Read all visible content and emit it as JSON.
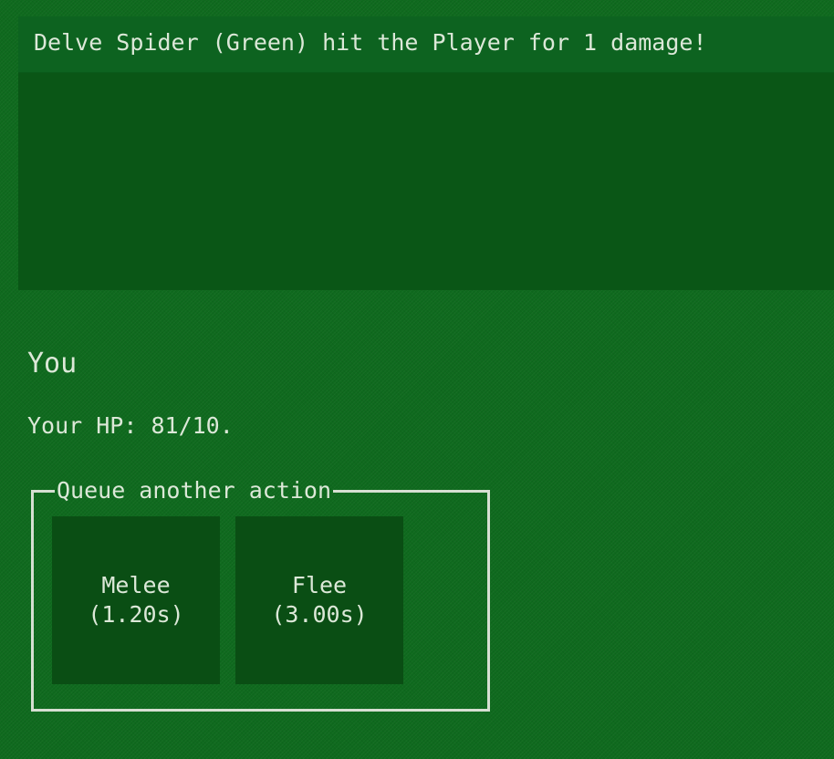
{
  "log": {
    "entries": [
      "Delve Spider (Green) hit the Player for 1 damage!"
    ]
  },
  "player": {
    "title": "You",
    "hp_text": "Your HP: 81/10."
  },
  "queue": {
    "legend": "Queue another action",
    "actions": [
      {
        "name": "Melee",
        "time": "(1.20s)"
      },
      {
        "name": "Flee",
        "time": "(3.00s)"
      }
    ]
  },
  "colors": {
    "background": "#0f6a1e",
    "panel": "#0a5616",
    "log_entry": "#0d6320",
    "button": "#0a4e14",
    "text": "#dce8d8",
    "border": "#d6dfd2"
  }
}
